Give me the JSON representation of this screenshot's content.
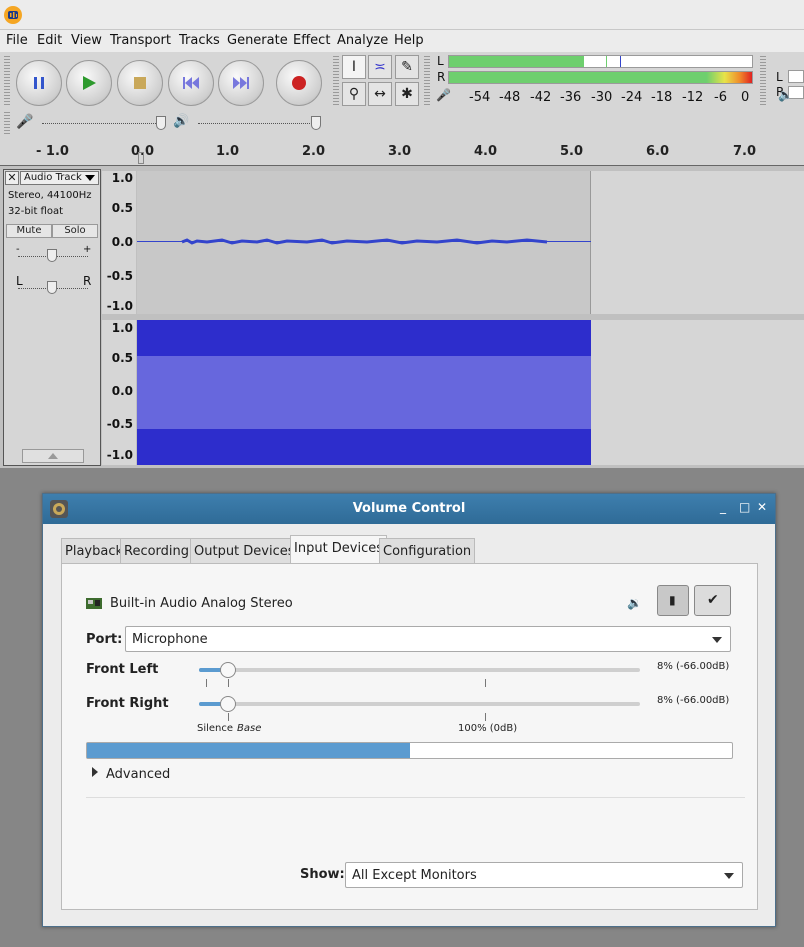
{
  "audacity": {
    "menu": [
      "File",
      "Edit",
      "View",
      "Transport",
      "Tracks",
      "Generate",
      "Effect",
      "Analyze",
      "Help"
    ],
    "meter": {
      "left_label": "L",
      "right_label": "R",
      "scale": [
        "-54",
        "-48",
        "-42",
        "-36",
        "-30",
        "-24",
        "-18",
        "-12",
        "-6",
        "0"
      ],
      "rec_left_label": "L",
      "rec_right_label": "R"
    },
    "ruler_ticks": [
      "- 1.0",
      "0.0",
      "1.0",
      "2.0",
      "3.0",
      "4.0",
      "5.0",
      "6.0",
      "7.0"
    ],
    "track": {
      "name": "Audio Track",
      "format": "Stereo, 44100Hz",
      "bitdepth": "32-bit float",
      "mute": "Mute",
      "solo": "Solo",
      "gain_minus": "-",
      "gain_plus": "+",
      "pan_left": "L",
      "pan_right": "R",
      "scale": [
        "1.0",
        "0.5",
        "0.0",
        "-0.5",
        "-1.0"
      ]
    }
  },
  "volume_control": {
    "title": "Volume Control",
    "tabs": [
      "Playback",
      "Recording",
      "Output Devices",
      "Input Devices",
      "Configuration"
    ],
    "active_tab": "Input Devices",
    "device_name": "Built-in Audio Analog Stereo",
    "port_label": "Port:",
    "port_value": "Microphone",
    "front_left_label": "Front Left",
    "front_left_value": "8% (-66.00dB)",
    "front_left_level": 0.08,
    "front_right_label": "Front Right",
    "front_right_value": "8% (-66.00dB)",
    "front_right_level": 0.08,
    "scale_silence": "Silence",
    "scale_base": "Base",
    "scale_100": "100% (0dB)",
    "peak_level": 0.5,
    "advanced_label": "Advanced",
    "show_label": "Show:",
    "show_value": "All Except Monitors"
  }
}
